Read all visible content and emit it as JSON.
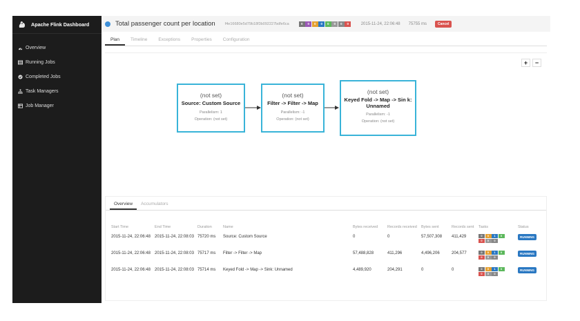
{
  "sidebar": {
    "brand": "Apache Flink Dashboard",
    "items": [
      {
        "label": "Overview",
        "icon": "dashboard-icon"
      },
      {
        "label": "Running Jobs",
        "icon": "running-jobs-icon"
      },
      {
        "label": "Completed Jobs",
        "icon": "check-circle-icon"
      },
      {
        "label": "Task Managers",
        "icon": "sitemap-icon"
      },
      {
        "label": "Job Manager",
        "icon": "table-icon"
      }
    ]
  },
  "header": {
    "title": "Total passenger count per location",
    "job_id": "f4e16680e5d79b18f3b092227bdfe6ca",
    "status_counts": [
      "0",
      "0",
      "0",
      "0",
      "0",
      "0",
      "0",
      "0"
    ],
    "start_time": "2015-11-24, 22:06:48",
    "duration": "75755 ms",
    "cancel_label": "Cancel"
  },
  "tabs": [
    "Plan",
    "Timeline",
    "Exceptions",
    "Properties",
    "Configuration"
  ],
  "plan": {
    "zoom_in": "+",
    "zoom_out": "−",
    "nodes": [
      {
        "label": "(not set)",
        "title": "Source: Custom Source",
        "parallelism": "Parallelism: 1",
        "operation": "Operation: (not set)"
      },
      {
        "label": "(not set)",
        "title": "Filter -> Filter -> Map",
        "parallelism": "Parallelism: -1",
        "operation": "Operation: (not set)"
      },
      {
        "label": "(not set)",
        "title": "Keyed Fold -> Map -> Sin k: Unnamed",
        "parallelism": "Parallelism: -1",
        "operation": "Operation: (not set)"
      }
    ]
  },
  "lower_tabs": [
    "Overview",
    "Accumulators"
  ],
  "table": {
    "headers": [
      "Start Time",
      "End Time",
      "Duration",
      "Name",
      "Bytes received",
      "Records received",
      "Bytes sent",
      "Records sent",
      "Tasks",
      "Status"
    ],
    "rows": [
      {
        "start": "2015-11-24, 22:06:48",
        "end": "2015-11-24, 22:08:03",
        "duration": "75720 ms",
        "name": "Source: Custom Source",
        "bytes_recv": "0",
        "records_recv": "0",
        "bytes_sent": "57,507,308",
        "records_sent": "411,429",
        "tasks": [
          "0",
          "0",
          "1",
          "0",
          "0",
          "0",
          "0"
        ],
        "status": "RUNNING"
      },
      {
        "start": "2015-11-24, 22:06:48",
        "end": "2015-11-24, 22:08:03",
        "duration": "75717 ms",
        "name": "Filter -> Filter -> Map",
        "bytes_recv": "57,488,828",
        "records_recv": "411,296",
        "bytes_sent": "4,496,206",
        "records_sent": "204,577",
        "tasks": [
          "0",
          "0",
          "1",
          "0",
          "0",
          "0",
          "0"
        ],
        "status": "RUNNING"
      },
      {
        "start": "2015-11-24, 22:06:48",
        "end": "2015-11-24, 22:08:03",
        "duration": "75714 ms",
        "name": "Keyed Fold -> Map -> Sink: Unnamed",
        "bytes_recv": "4,489,920",
        "records_recv": "204,291",
        "bytes_sent": "0",
        "records_sent": "0",
        "tasks": [
          "0",
          "0",
          "1",
          "0",
          "0",
          "0",
          "0"
        ],
        "status": "RUNNING"
      }
    ]
  },
  "colors": {
    "node_border": "#38b3d8",
    "running": "#2a78c2",
    "cancel": "#d9534f",
    "sidebar_bg": "#1c1c1c"
  }
}
